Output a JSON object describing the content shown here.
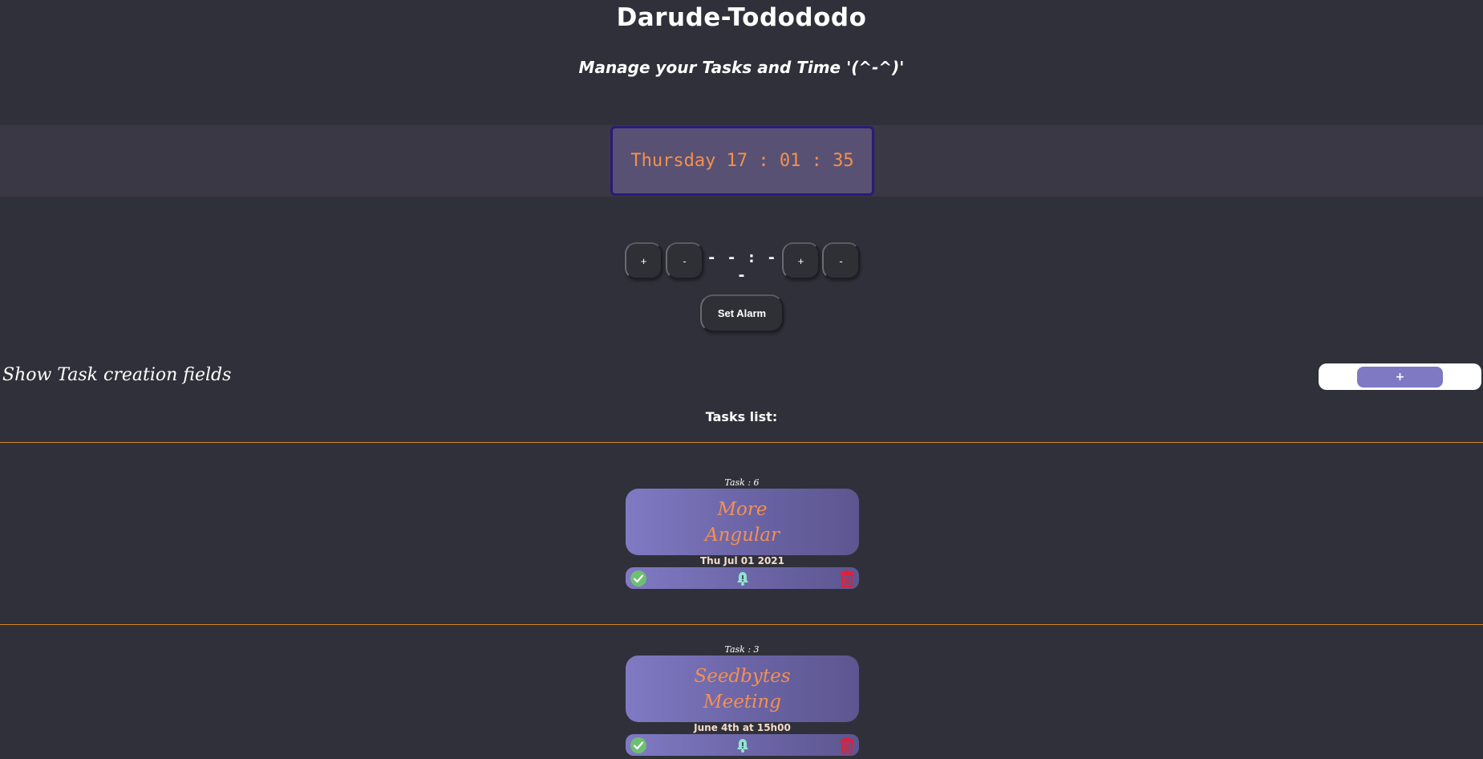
{
  "header": {
    "title": "Darude-Todododo",
    "subtitle": "Manage your Tasks and Time '(^-^)'"
  },
  "clock": {
    "display": "Thursday 17 : 01 : 35",
    "text_color": "#f4904f"
  },
  "alarm": {
    "hours_plus": "+",
    "hours_minus": "-",
    "display": "- - : - -",
    "minutes_plus": "+",
    "minutes_minus": "-",
    "set_label": "Set Alarm"
  },
  "task_creation": {
    "toggle_label": "Show Task creation fields",
    "toggle_button": "+"
  },
  "tasks_list": {
    "title": "Tasks list:",
    "tasks": [
      {
        "number_label": "Task : 6",
        "title_line1": "More",
        "title_line2": "Angular",
        "date": "Thu Jul 01 2021"
      },
      {
        "number_label": "Task : 3",
        "title_line1": "Seedbytes",
        "title_line2": "Meeting",
        "date": "June 4th at 15h00"
      }
    ]
  },
  "icons": {
    "complete": "check-circle-icon",
    "alarm": "bell-icon",
    "delete": "trash-icon"
  },
  "colors": {
    "background": "#30303a",
    "accent": "#7f78c3",
    "divider": "#d9862b",
    "task_title": "#f4904f",
    "delete": "#e0203a",
    "complete": "#6fbf73",
    "bell": "#8fe3d2"
  }
}
